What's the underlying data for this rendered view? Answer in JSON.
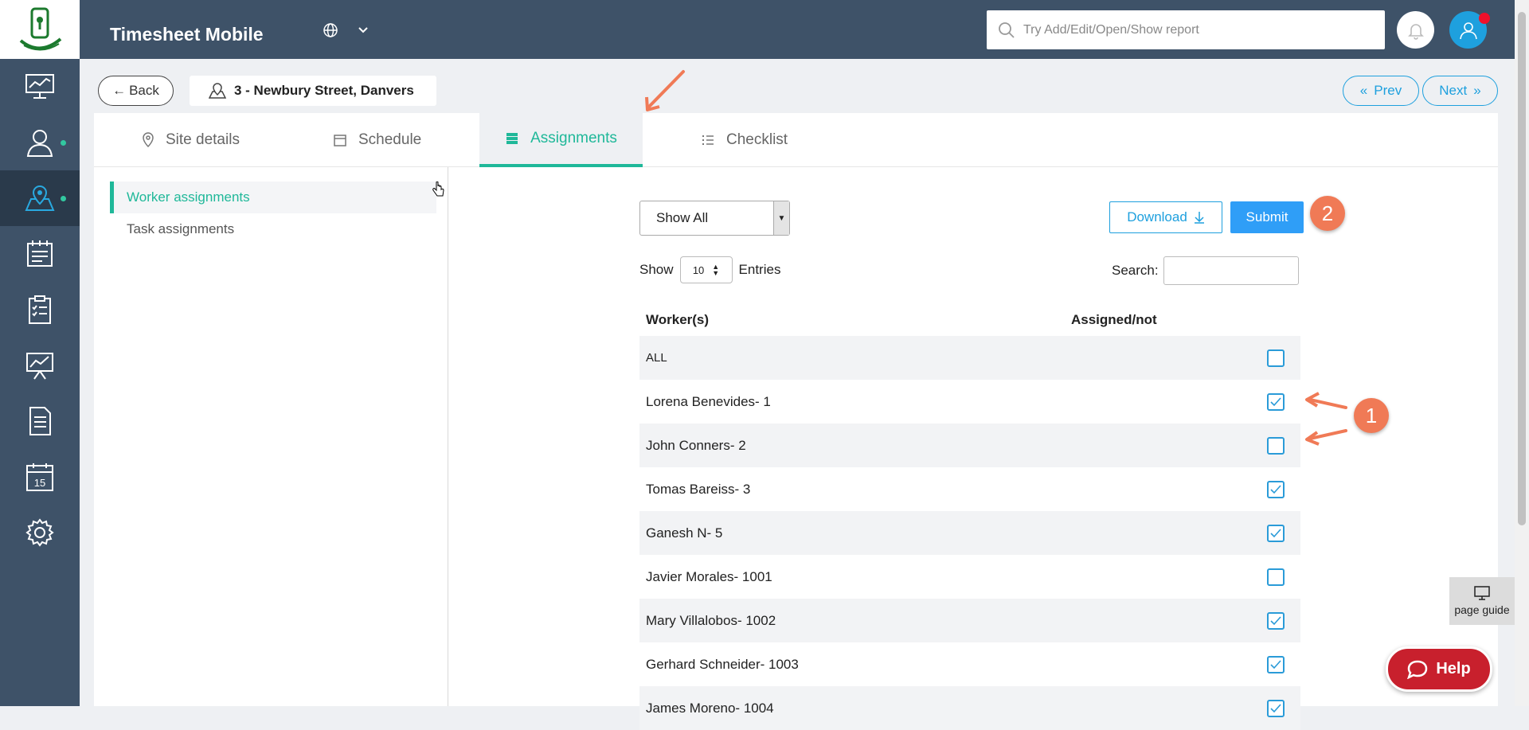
{
  "app": {
    "title": "Timesheet Mobile"
  },
  "topbar": {
    "search_placeholder": "Try Add/Edit/Open/Show report"
  },
  "sidebar": {
    "items": [
      {
        "icon": "dashboard-icon"
      },
      {
        "icon": "workers-icon",
        "has_dot": true
      },
      {
        "icon": "sites-icon",
        "has_dot": true,
        "active": true
      },
      {
        "icon": "jobs-icon"
      },
      {
        "icon": "tasks-icon"
      },
      {
        "icon": "reports-icon"
      },
      {
        "icon": "document-icon"
      },
      {
        "icon": "calendar-icon",
        "text": "15"
      },
      {
        "icon": "settings-icon"
      }
    ]
  },
  "header": {
    "back_label": "Back",
    "site_name": "3 - Newbury Street, Danvers",
    "prev_label": "Prev",
    "next_label": "Next"
  },
  "tabs": [
    {
      "label": "Site details"
    },
    {
      "label": "Schedule"
    },
    {
      "label": "Assignments",
      "active": true
    },
    {
      "label": "Checklist"
    }
  ],
  "sub_nav": [
    {
      "label": "Worker assignments",
      "active": true
    },
    {
      "label": "Task assignments"
    }
  ],
  "controls": {
    "filter_value": "Show All",
    "download_label": "Download",
    "submit_label": "Submit",
    "show_label": "Show",
    "entries_value": "10",
    "entries_label": "Entries",
    "search_label": "Search:"
  },
  "table": {
    "columns": [
      "Worker(s)",
      "Assigned/not"
    ],
    "rows": [
      {
        "name": "ALL",
        "checked": false
      },
      {
        "name": "Lorena Benevides- 1",
        "checked": true
      },
      {
        "name": "John Conners- 2",
        "checked": false
      },
      {
        "name": "Tomas Bareiss- 3",
        "checked": true
      },
      {
        "name": "Ganesh N- 5",
        "checked": true
      },
      {
        "name": "Javier Morales- 1001",
        "checked": false
      },
      {
        "name": "Mary Villalobos- 1002",
        "checked": true
      },
      {
        "name": "Gerhard Schneider- 1003",
        "checked": true
      },
      {
        "name": "James Moreno- 1004",
        "checked": true
      }
    ]
  },
  "annotations": {
    "badge_1": "1",
    "badge_2": "2"
  },
  "page_guide_label": "page guide",
  "help_label": "Help",
  "colors": {
    "accent": "#1fb899",
    "primary": "#1ea0de",
    "topbar": "#3e5268",
    "annotation": "#f07a56"
  }
}
